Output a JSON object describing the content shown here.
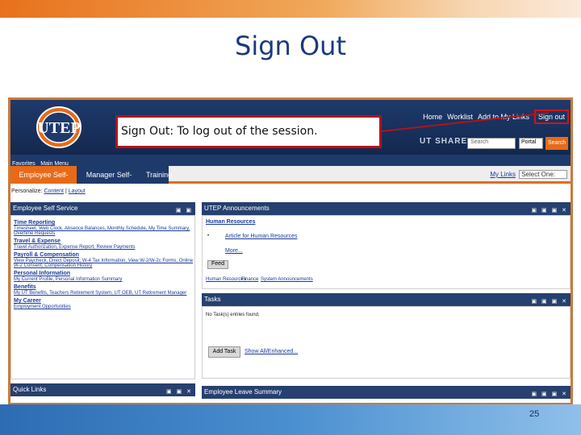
{
  "slide": {
    "title": "Sign Out",
    "page_number": "25"
  },
  "callout": {
    "label": "Sign Out",
    "text": ": To log out of the session."
  },
  "header": {
    "links": [
      "Home",
      "Worklist",
      "Add to My Links",
      "Sign out"
    ],
    "brand": "UT SHARE",
    "search_placeholder": "Search",
    "portal_option": "Portal",
    "search_button": "Search"
  },
  "favbar": {
    "favorites": "Favorites",
    "main_menu": "Main Menu"
  },
  "tabs": [
    "Employee Self-Service",
    "Manager Self-Service",
    "Training"
  ],
  "mylinks": {
    "label": "My Links",
    "select": "Select One:"
  },
  "personalize": {
    "label": "Personalize:",
    "content": "Content",
    "layout": "Layout"
  },
  "panels": {
    "ess": {
      "title": "Employee Self Service",
      "sections": [
        {
          "heading": "Time Reporting",
          "links": "Timesheet, Web Clock, Absence Balances, Monthly Schedule, My Time Summary, Overtime Requests"
        },
        {
          "heading": "Travel & Expense",
          "links": "Travel Authorization, Expense Report, Review Payments"
        },
        {
          "heading": "Payroll & Compensation",
          "links": "View Paycheck, Direct Deposit, W-4 Tax Information, View W-2/W-2c Forms, Online W-2 Consent, Compensation History"
        },
        {
          "heading": "Personal Information",
          "links": "My Current Profile, Personal Information Summary"
        },
        {
          "heading": "Benefits",
          "links": "My UT Benefits, Teachers Retirement System, UT OEB, UT Retirement Manager"
        },
        {
          "heading": "My Career",
          "links": "Employment Opportunities"
        }
      ]
    },
    "quick_links": {
      "title": "Quick Links"
    },
    "announcements": {
      "title": "UTEP Announcements",
      "hr_heading": "Human Resources",
      "hr_item": "Article for Human Resources",
      "more": "More...",
      "feed": "Feed",
      "footer_links": [
        "Human Resources",
        "Finance",
        "System Announcements"
      ]
    },
    "tasks": {
      "title": "Tasks",
      "empty": "No Task(s) entries found.",
      "add_button": "Add Task",
      "show_all": "Show All/Enhanced..."
    },
    "leave": {
      "title": "Employee Leave Summary"
    }
  },
  "colors": {
    "accent_orange": "#e86a17",
    "header_navy": "#1e3a6b",
    "title_blue": "#1a3a7a",
    "callout_red": "#b0141d"
  }
}
